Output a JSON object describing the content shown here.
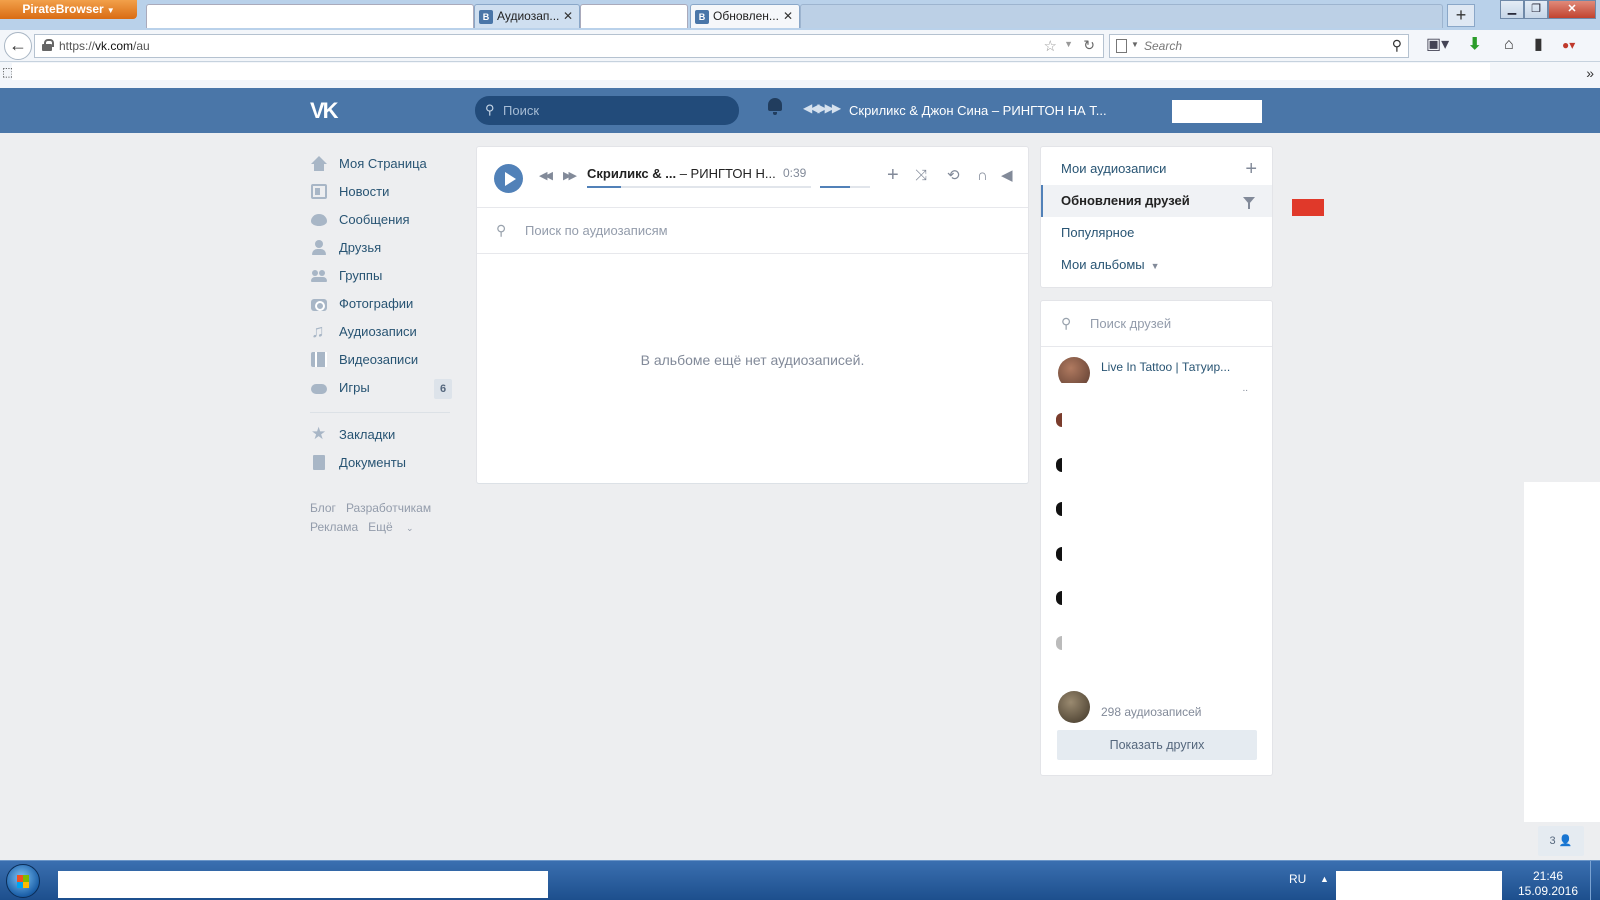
{
  "browser": {
    "app_button": "PirateBrowser",
    "tabs": [
      {
        "label": "",
        "kind": "blank"
      },
      {
        "label": "Аудиозап...",
        "kind": "vk"
      },
      {
        "label": "",
        "kind": "blank"
      },
      {
        "label": "Обновлен...",
        "kind": "vk"
      }
    ],
    "new_tab": "+",
    "url_scheme": "https://",
    "url_host": "vk.com",
    "url_path": "/au",
    "search_placeholder": "Search"
  },
  "vk": {
    "logo": "VK",
    "search_placeholder": "Поиск",
    "now_playing": "Скриликс & Джон Сина – РИНГТОН НА Т...",
    "nav": [
      {
        "label": "Моя Страница",
        "icon": "home-icon"
      },
      {
        "label": "Новости",
        "icon": "news-icon"
      },
      {
        "label": "Сообщения",
        "icon": "messages-icon"
      },
      {
        "label": "Друзья",
        "icon": "friends-icon"
      },
      {
        "label": "Группы",
        "icon": "groups-icon"
      },
      {
        "label": "Фотографии",
        "icon": "photos-icon"
      },
      {
        "label": "Аудиозаписи",
        "icon": "audio-icon"
      },
      {
        "label": "Видеозаписи",
        "icon": "video-icon"
      },
      {
        "label": "Игры",
        "icon": "games-icon",
        "badge": "6"
      }
    ],
    "nav2": [
      {
        "label": "Закладки",
        "icon": "bookmarks-icon"
      },
      {
        "label": "Документы",
        "icon": "documents-icon"
      }
    ],
    "footer": [
      "Блог",
      "Разработчикам",
      "Реклама",
      "Ещё"
    ],
    "player": {
      "artist": "Скриликс & ...",
      "title": "– РИНГТОН Н...",
      "time": "0:39",
      "progress": 0.15,
      "volume": 0.6
    },
    "audio_search_placeholder": "Поиск по аудиозаписям",
    "empty_message": "В альбоме ещё нет аудиозаписей.",
    "right_menu": [
      {
        "label": "Мои аудиозаписи"
      },
      {
        "label": "Обновления друзей",
        "active": true
      },
      {
        "label": "Популярное"
      },
      {
        "label": "Мои альбомы"
      }
    ],
    "friends_search_placeholder": "Поиск друзей",
    "friend_top_name": "Live In Tattoo | Татуир...",
    "friend_bottom_count": "298 аудиозаписей",
    "show_more": "Показать других",
    "online_count": "3"
  },
  "taskbar": {
    "lang": "RU",
    "time": "21:46",
    "date": "15.09.2016"
  },
  "colors": {
    "vk_header": "#4a76a8",
    "vk_accent": "#5181b8",
    "page_bg": "#edeef0",
    "link": "#285473"
  }
}
